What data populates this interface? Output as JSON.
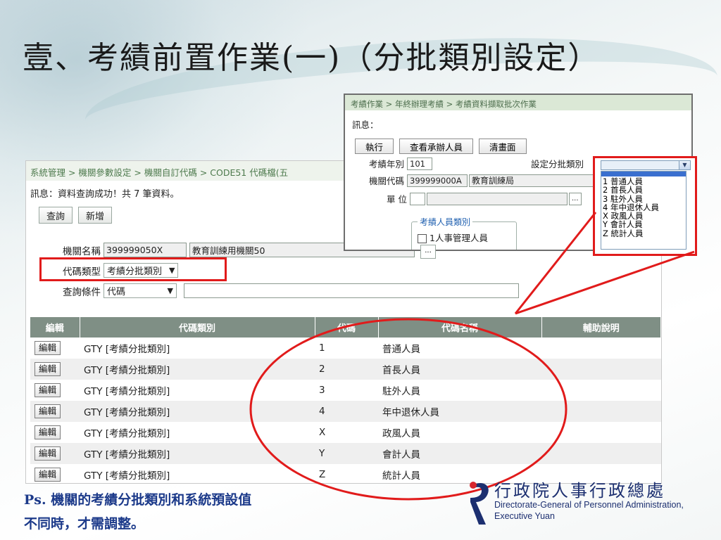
{
  "slide": {
    "title": "壹、考績前置作業(一)（分批類別設定）",
    "footnote_line1": "Ps. 機關的考績分批類別和系統預設值",
    "footnote_line2": "不同時，才需調整。",
    "logo_cn": "行政院人事行政總處",
    "logo_en_line1": "Directorate-General of Personnel Administration,",
    "logo_en_line2": "Executive Yuan"
  },
  "main_window": {
    "breadcrumb": "系統管理 > 機關參數設定 > 機關自訂代碼 > CODE51 代碼檔(五",
    "message": "訊息：資料查詢成功！共 7 筆資料。",
    "buttons": {
      "query": "查詢",
      "add": "新增"
    },
    "form": {
      "agency_label": "機關名稱",
      "agency_code": "399999050X",
      "agency_name": "教育訓練用機關50",
      "agency_browse": "...",
      "code_type_label": "代碼類型",
      "code_type_value": "考績分批類別",
      "query_cond_label": "查詢條件",
      "query_cond_value": "代碼",
      "query_text": ""
    },
    "table": {
      "headers": [
        "編輯",
        "代碼類別",
        "代碼",
        "代碼名稱",
        "輔助說明"
      ],
      "edit_label": "編輯",
      "rows": [
        {
          "category": "GTY [考績分批類別]",
          "code": "1",
          "name": "普通人員",
          "note": ""
        },
        {
          "category": "GTY [考績分批類別]",
          "code": "2",
          "name": "首長人員",
          "note": ""
        },
        {
          "category": "GTY [考績分批類別]",
          "code": "3",
          "name": "駐外人員",
          "note": ""
        },
        {
          "category": "GTY [考績分批類別]",
          "code": "4",
          "name": "年中退休人員",
          "note": ""
        },
        {
          "category": "GTY [考績分批類別]",
          "code": "X",
          "name": "政風人員",
          "note": ""
        },
        {
          "category": "GTY [考績分批類別]",
          "code": "Y",
          "name": "會計人員",
          "note": ""
        },
        {
          "category": "GTY [考績分批類別]",
          "code": "Z",
          "name": "統計人員",
          "note": ""
        }
      ]
    }
  },
  "popup_window": {
    "breadcrumb": "考績作業 > 年終辦理考績 > 考績資料擷取批次作業",
    "message": "訊息：",
    "buttons": {
      "execute": "執行",
      "view_handlers": "查看承辦人員",
      "clear": "清畫面"
    },
    "year_label": "考績年別",
    "year_value": "101",
    "batch_label": "設定分批類別",
    "agency_label": "機關代碼",
    "agency_code": "399999000A",
    "agency_name": "教育訓練局",
    "unit_label": "單 位",
    "browse": "...",
    "staff_type_legend": "考績人員類別",
    "staff_type_option": "1人事管理人員"
  },
  "dropdown": {
    "selected": "",
    "options": [
      "1 普通人員",
      "2 首長人員",
      "3 駐外人員",
      "4 年中退休人員",
      "X 政風人員",
      "Y 會計人員",
      "Z 統計人員"
    ]
  },
  "colors": {
    "highlight": "#e11b1b",
    "table_header": "#7f8f85",
    "footnote": "#1c3a8a"
  }
}
